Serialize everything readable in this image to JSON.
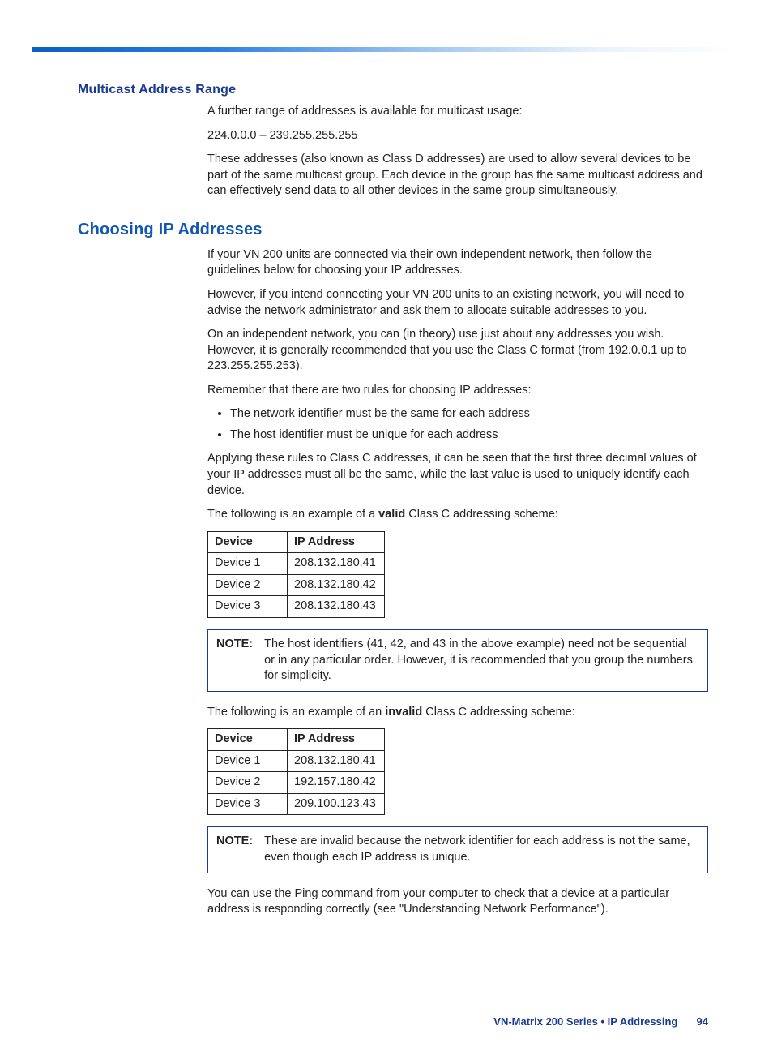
{
  "topbar": {},
  "section_multicast": {
    "heading": "Multicast Address Range",
    "p1": "A further range of addresses is available for multicast usage:",
    "range": "224.0.0.0 – 239.255.255.255",
    "p2": "These addresses (also known as Class D addresses) are used to allow several devices to be part of the same multicast group. Each device in the group has the same multicast address and can effectively send data to all other devices in the same group simultaneously."
  },
  "section_choosing": {
    "heading": "Choosing IP Addresses",
    "p1": "If your VN 200 units are connected via their own independent network, then follow the guidelines below for choosing your IP addresses.",
    "p2": "However, if you intend connecting your VN 200 units to an existing network, you will need to advise the network administrator and ask them to allocate suitable addresses to you.",
    "p3": "On an independent network, you can (in theory) use just about any addresses you wish. However, it is generally recommended that you use the Class C format (from 192.0.0.1 up to 223.255.255.253).",
    "p4": "Remember that there are two rules for choosing IP addresses:",
    "bullets": [
      "The network identifier must be the same for each address",
      "The host identifier must be unique for each address"
    ],
    "p5": "Applying these rules to Class C addresses, it can be seen that the first three decimal values of your IP addresses must all be the same, while the last value is used to uniquely identify each device.",
    "valid_intro_pre": "The following is an example of a ",
    "valid_intro_bold": "valid",
    "valid_intro_post": " Class C addressing scheme:",
    "invalid_intro_pre": "The following is an example of an ",
    "invalid_intro_bold": "invalid",
    "invalid_intro_post": " Class C addressing scheme:",
    "p_end": "You can use the Ping command from your computer to check that a device at a particular address is responding correctly (see \"Understanding Network Performance\")."
  },
  "table": {
    "col_device": "Device",
    "col_ip": "IP Address"
  },
  "table_valid": {
    "rows": [
      {
        "device": "Device 1",
        "ip": "208.132.180.41"
      },
      {
        "device": "Device 2",
        "ip": "208.132.180.42"
      },
      {
        "device": "Device 3",
        "ip": "208.132.180.43"
      }
    ]
  },
  "table_invalid": {
    "rows": [
      {
        "device": "Device 1",
        "ip": "208.132.180.41"
      },
      {
        "device": "Device 2",
        "ip": "192.157.180.42"
      },
      {
        "device": "Device 3",
        "ip": "209.100.123.43"
      }
    ]
  },
  "note1": {
    "label": "NOTE:",
    "text": "The host identifiers (41, 42, and 43 in the above example) need not be sequential or in any particular order. However, it is recommended that you group the numbers for simplicity."
  },
  "note2": {
    "label": "NOTE:",
    "text": "These are invalid because the network identifier for each address is not the same, even though each IP address is unique."
  },
  "footer": {
    "text": "VN-Matrix 200 Series  •  IP Addressing",
    "page": "94"
  }
}
